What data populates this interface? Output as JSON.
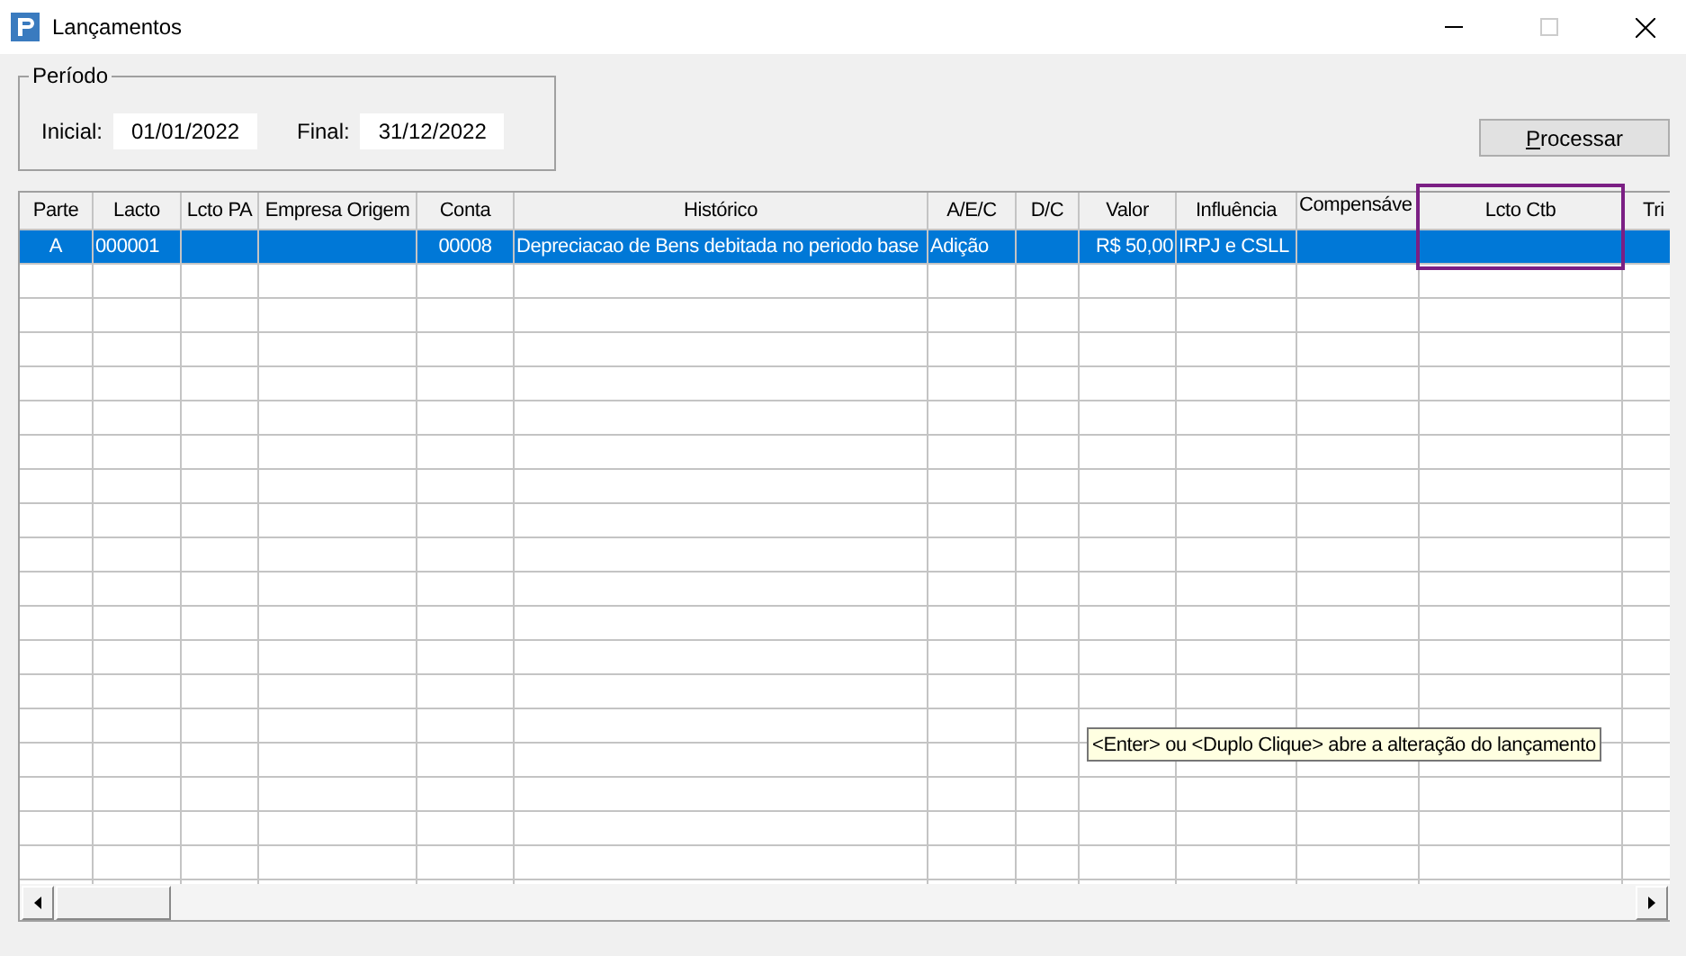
{
  "window": {
    "title": "Lançamentos"
  },
  "periodo": {
    "legend": "Período",
    "inicial_label": "Inicial:",
    "inicial": "01/01/2022",
    "final_label": "Final:",
    "final": "31/12/2022"
  },
  "process_button": "Processar",
  "table": {
    "columns": [
      "Parte",
      "Lacto",
      "Lcto PA",
      "Empresa Origem",
      "Conta",
      "Histórico",
      "A/E/C",
      "D/C",
      "Valor",
      "Influência",
      "Compensáve",
      "Lcto Ctb",
      "Tri"
    ],
    "rows": [
      {
        "selected": true,
        "cells": [
          "A",
          "000001",
          null,
          null,
          "00008",
          "Depreciacao de Bens debitada no periodo base",
          "Adição",
          null,
          "R$ 50,00",
          "IRPJ e CSLL",
          null,
          null,
          null
        ]
      }
    ]
  },
  "tooltip": "<Enter> ou <Duplo Clique> abre a alteração do lançamento"
}
